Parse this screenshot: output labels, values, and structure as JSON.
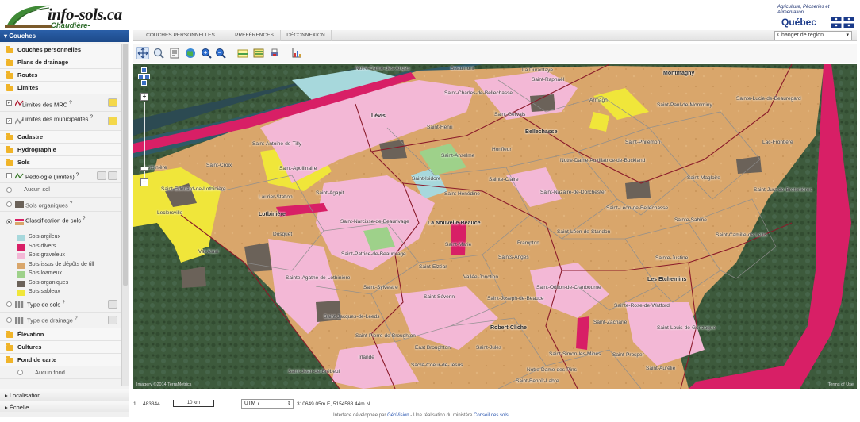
{
  "header": {
    "logo_main": "info-sols.ca",
    "logo_sub": "Chaudière-Appalaches",
    "ministry": "Agriculture, Pêcheries et Alimentation",
    "government": "Québec"
  },
  "left_panel": {
    "title": "Couches",
    "groups": {
      "personal": "Couches personnelles",
      "drainage": "Plans de drainage",
      "roads": "Routes",
      "limits": "Limites",
      "cadastre": "Cadastre",
      "hydro": "Hydrographie",
      "soils": "Sols",
      "elevation": "Élévation",
      "crops": "Cultures",
      "basemap": "Fond de carte"
    },
    "limits_items": [
      {
        "label": "Limites des MRC",
        "help": "?"
      },
      {
        "label": "Limites des municipalités",
        "help": "?"
      }
    ],
    "soils_items": {
      "pedologie": "Pédologie (limites)",
      "pedologie_help": "?",
      "aucun": "Aucun sol",
      "sols_organiques": "Sols organiques",
      "sols_organiques_help": "?",
      "classification": "Classification de sols",
      "classification_help": "?",
      "type_de_sols": "Type de sols",
      "type_de_sols_help": "?",
      "type_de_drainage": "Type de drainage",
      "type_de_drainage_help": "?"
    },
    "legend": [
      {
        "label": "Sols argileux",
        "color": "#a7d8dc"
      },
      {
        "label": "Sols divers",
        "color": "#d81f66"
      },
      {
        "label": "Sols graveleux",
        "color": "#f3b8d6"
      },
      {
        "label": "Sols issus de dépôts de till",
        "color": "#d9a66b"
      },
      {
        "label": "Sols loameux",
        "color": "#9ed18a"
      },
      {
        "label": "Sols organiques",
        "color": "#6b6259"
      },
      {
        "label": "Sols sableux",
        "color": "#f0e63a"
      }
    ],
    "basemap_item": "Aucun fond",
    "bottom": [
      "Localisation",
      "Échelle"
    ]
  },
  "tabs": [
    "COUCHES PERSONNELLES",
    "PRÉFÉRENCES",
    "DÉCONNEXION"
  ],
  "region_select": "Changer de région",
  "map": {
    "places": [
      {
        "name": "Notre-Dame-des-Anges"
      },
      {
        "name": "Beaumont"
      },
      {
        "name": "La Durantaye"
      },
      {
        "name": "Saint-Raphaël"
      },
      {
        "name": "Montmagny",
        "big": true
      },
      {
        "name": "Saint-Charles-de-Bellechasse"
      },
      {
        "name": "Armagh"
      },
      {
        "name": "Saint-Paul-de-Montminy"
      },
      {
        "name": "Sainte-Lucie-de-Beauregard"
      },
      {
        "name": "Saint-Gervais"
      },
      {
        "name": "Lévis",
        "big": true
      },
      {
        "name": "Saint-Henri"
      },
      {
        "name": "Bellechasse",
        "big": true
      },
      {
        "name": "Saint-Philémon"
      },
      {
        "name": "Lac-Frontière"
      },
      {
        "name": "Saint-Antoine-de-Tilly"
      },
      {
        "name": "Honfleur"
      },
      {
        "name": "Saint-Anselme"
      },
      {
        "name": "Notre-Dame-Auxiliatrice-de-Buckland"
      },
      {
        "name": "Saint-Croix"
      },
      {
        "name": "Saint-Apollinaire"
      },
      {
        "name": "Lotbinière"
      },
      {
        "name": "Saint-Isidore"
      },
      {
        "name": "Sainte-Claire"
      },
      {
        "name": "Saint-Magloire"
      },
      {
        "name": "Saint-Édouard-de-Lotbinière"
      },
      {
        "name": "Saint-Agapit"
      },
      {
        "name": "Saint-Hénédine"
      },
      {
        "name": "Saint-Nazaire-de-Dorchester"
      },
      {
        "name": "Saint-Just-de-Bretenières"
      },
      {
        "name": "Laurier-Station"
      },
      {
        "name": "Saint-Léon-de-Bellechasse"
      },
      {
        "name": "Leclercville"
      },
      {
        "name": "Lotbinière",
        "big": true
      },
      {
        "name": "Saint-Narcisse-de-Beaurivage"
      },
      {
        "name": "La Nouvelle-Beauce",
        "big": true
      },
      {
        "name": "Saint-Léon-de-Standon"
      },
      {
        "name": "Sainte-Sabine"
      },
      {
        "name": "Saint-Camille-de-Lellis"
      },
      {
        "name": "Dosquet"
      },
      {
        "name": "Frampton"
      },
      {
        "name": "Val-Alain"
      },
      {
        "name": "Saint-Patrice-de-Beaurivage"
      },
      {
        "name": "Saint-Marie"
      },
      {
        "name": "Saints-Anges"
      },
      {
        "name": "Sainte-Justine"
      },
      {
        "name": "Saint-Elzéar"
      },
      {
        "name": "Vallée-Jonction"
      },
      {
        "name": "Sainte-Agathe-de-Lotbinière"
      },
      {
        "name": "Les Etchemins",
        "big": true
      },
      {
        "name": "Saint-Odilon-de-Cranbourne"
      },
      {
        "name": "Saint-Sylvestre"
      },
      {
        "name": "Saint-Séverin"
      },
      {
        "name": "Saint-Joseph-de-Beauce"
      },
      {
        "name": "Sainte-Rose-de-Watford"
      },
      {
        "name": "Saint-Jacques-de-Leeds"
      },
      {
        "name": "Robert-Cliche",
        "big": true
      },
      {
        "name": "Saint-Zacharie"
      },
      {
        "name": "Saint-Louis-de-Gonzague"
      },
      {
        "name": "Saint-Pierre-de-Broughton"
      },
      {
        "name": "East Broughton"
      },
      {
        "name": "Saint-Jules"
      },
      {
        "name": "Saint-Simon-les-Mines"
      },
      {
        "name": "Saint-Prosper"
      },
      {
        "name": "Saint-Aurélie"
      },
      {
        "name": "Irlande"
      },
      {
        "name": "Sacré-Coeur-de-Jésus"
      },
      {
        "name": "Notre-Dame-des-Pins"
      },
      {
        "name": "Saint-Jean-de-Brébeuf"
      },
      {
        "name": "Saint-Benoît-Labre"
      }
    ],
    "attribution_left": "Imagery ©2014 TerraMetrics",
    "attribution_right": "Terms of Use"
  },
  "status": {
    "index": "1",
    "scale_value": "483344",
    "scale_bar": "10 km",
    "projection": "UTM 7",
    "coords": "310649.05m E, 5154588.44m N"
  },
  "footer": {
    "text_pre": "Interface développée par ",
    "link1": "GéoVision",
    "text_mid": " - Une réalisation du ministère ",
    "link2": "Conseil des sols"
  }
}
